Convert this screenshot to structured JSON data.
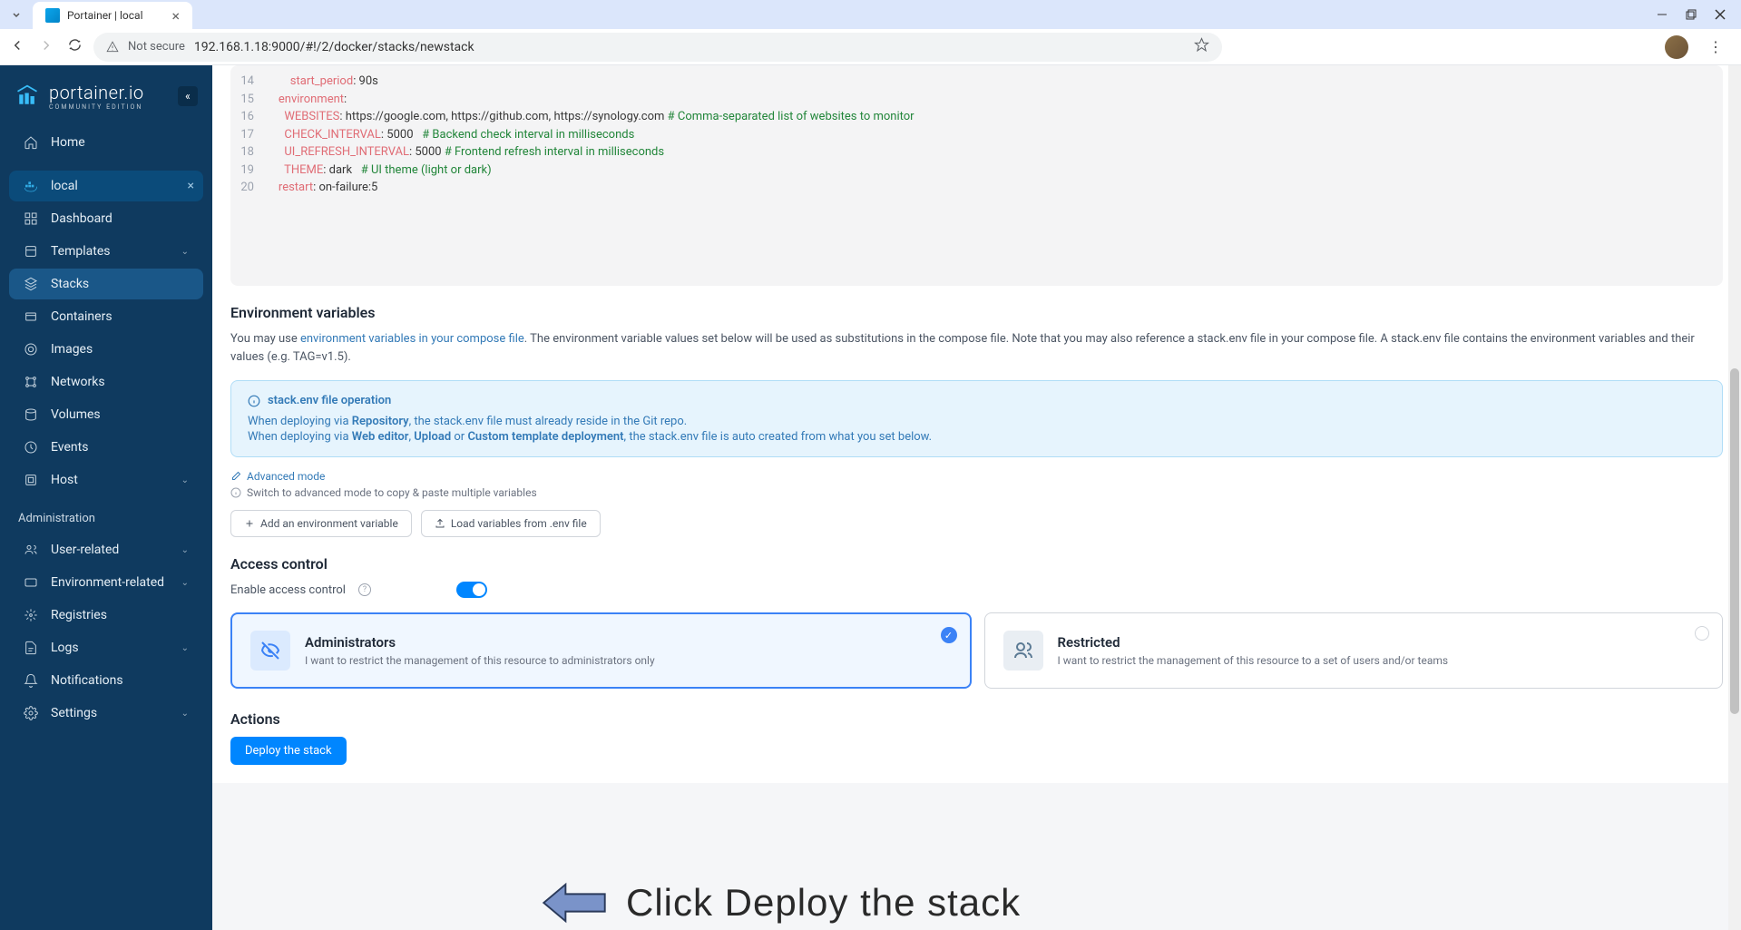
{
  "browser": {
    "tab_title": "Portainer | local",
    "not_secure": "Not secure",
    "url": "192.168.1.18:9000/#!/2/docker/stacks/newstack"
  },
  "sidebar": {
    "brand": "portainer.io",
    "edition": "COMMUNITY EDITION",
    "home": "Home",
    "env_label": "local",
    "items": [
      {
        "label": "Dashboard"
      },
      {
        "label": "Templates",
        "chevron": true
      },
      {
        "label": "Stacks",
        "active": true
      },
      {
        "label": "Containers"
      },
      {
        "label": "Images"
      },
      {
        "label": "Networks"
      },
      {
        "label": "Volumes"
      },
      {
        "label": "Events"
      },
      {
        "label": "Host",
        "chevron": true
      }
    ],
    "admin_header": "Administration",
    "admin_items": [
      {
        "label": "User-related",
        "chevron": true
      },
      {
        "label": "Environment-related",
        "chevron": true
      },
      {
        "label": "Registries"
      },
      {
        "label": "Logs",
        "chevron": true
      },
      {
        "label": "Notifications"
      },
      {
        "label": "Settings",
        "chevron": true
      }
    ]
  },
  "code": {
    "lines": [
      {
        "num": "14",
        "indent": "        ",
        "key": "start_period",
        "val": ": 90s"
      },
      {
        "num": "15",
        "indent": "    ",
        "key": "environment",
        "val": ":"
      },
      {
        "num": "16",
        "indent": "      ",
        "key": "WEBSITES",
        "val": ": https://google.com, https://github.com, https://synology.com ",
        "comment": "# Comma-separated list of websites to monitor"
      },
      {
        "num": "17",
        "indent": "      ",
        "key": "CHECK_INTERVAL",
        "val": ": 5000   ",
        "comment": "# Backend check interval in milliseconds"
      },
      {
        "num": "18",
        "indent": "      ",
        "key": "UI_REFRESH_INTERVAL",
        "val": ": 5000 ",
        "comment": "# Frontend refresh interval in milliseconds"
      },
      {
        "num": "19",
        "indent": "      ",
        "key": "THEME",
        "val": ": dark   ",
        "comment": "# UI theme (light or dark)"
      },
      {
        "num": "20",
        "indent": "    ",
        "key": "restart",
        "val": ": on-failure:5"
      }
    ]
  },
  "env": {
    "heading": "Environment variables",
    "desc_pre": "You may use ",
    "desc_link": "environment variables in your compose file",
    "desc_post": ". The environment variable values set below will be used as substitutions in the compose file. Note that you may also reference a stack.env file in your compose file. A stack.env file contains the environment variables and their values (e.g. TAG=v1.5).",
    "info_title": "stack.env file operation",
    "info_l1a": "When deploying via ",
    "info_l1b": "Repository",
    "info_l1c": ", the stack.env file must already reside in the Git repo.",
    "info_l2a": "When deploying via ",
    "info_l2b": "Web editor",
    "info_l2c": ", ",
    "info_l2d": "Upload",
    "info_l2e": " or ",
    "info_l2f": "Custom template deployment",
    "info_l2g": ", the stack.env file is auto created from what you set below.",
    "adv_mode": "Advanced mode",
    "adv_note": "Switch to advanced mode to copy & paste multiple variables",
    "btn_add": "Add an environment variable",
    "btn_load": "Load variables from .env file"
  },
  "access": {
    "heading": "Access control",
    "toggle_label": "Enable access control",
    "card1_title": "Administrators",
    "card1_desc": "I want to restrict the management of this resource to administrators only",
    "card2_title": "Restricted",
    "card2_desc": "I want to restrict the management of this resource to a set of users and/or teams"
  },
  "actions": {
    "heading": "Actions",
    "deploy": "Deploy the stack"
  },
  "annotation": {
    "text": "Click Deploy the stack"
  }
}
